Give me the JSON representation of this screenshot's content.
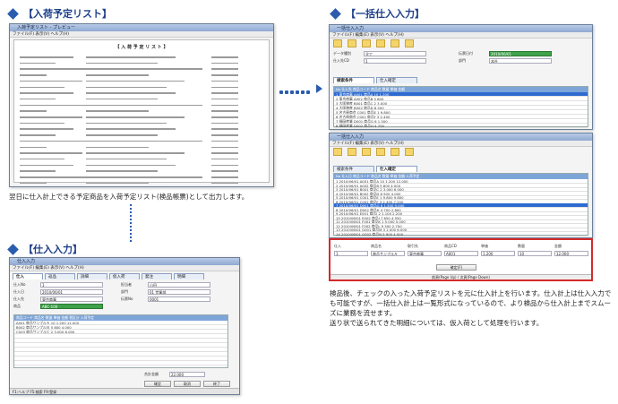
{
  "sections": {
    "schedule": {
      "heading": "【入荷予定リスト】",
      "desc": "翌日に仕入計上できる予定商品を入荷予定リスト(検品帳票)として出力します。"
    },
    "bulk": {
      "heading": "【一括仕入入力】",
      "desc": "検品後、チェックの入った入荷予定リストを元に仕入計上を行います。仕入計上は仕入入力でも可能ですが、一括仕入計上は一覧形式になっているので、より検品から仕入計上までスムーズに業務を流せます。\n送り状で送られてきた明細については、仮入荷として処理を行います。"
    },
    "entry": {
      "heading": "【仕入入力】"
    }
  },
  "report": {
    "title": "【 入 荷 予 定 リ ス ト 】"
  },
  "entry_win": {
    "title": "仕入入力",
    "menu": "ファイル(F)  編集(E)  表示(V)  ヘルプ(H)",
    "tabs": [
      "仕入",
      "返品",
      "詳細",
      "仮入荷",
      "発注",
      "明細"
    ],
    "labels": [
      "仕入No",
      "仕入日",
      "仕入先",
      "商品",
      "担当者",
      "部門",
      "伝票No"
    ],
    "values": [
      "1",
      "2010/06/01",
      "東京商事",
      "ABC-100",
      "山田",
      "01 営業部",
      "0001"
    ],
    "grid_header": "商品コード  商品名  数量  単価  金額  税区分  入荷予定",
    "rows": [
      "A001  商品サンプルＡ  10  1,200  12,000",
      "B002  商品サンプルＢ  5  800  4,000",
      "C003  商品サンプルＣ  2  3,000  6,000"
    ],
    "total_label": "合計金額",
    "total_value": "22,000",
    "buttons": [
      "確定",
      "取消",
      "終了"
    ],
    "status": "F1:ヘルプ  F5:検索  F9:登録"
  },
  "bulk_win_top": {
    "title": "一括仕入入力",
    "menu": "ファイル(F)  編集(E)  表示(V)  ヘルプ(H)",
    "labels": [
      "データ種別",
      "伝票日付",
      "仕入先CD",
      "部門"
    ],
    "values": [
      "全て",
      "2010/06/01",
      "1",
      "本社"
    ],
    "tabs": [
      "検索条件",
      "仕入確定"
    ],
    "grid_header": "No  仕入先  商品コード  商品名  数量  単価  金額",
    "rows": [
      "1  東京商事  A001  商品A  10  1,200",
      "2  東京商事  A002  商品B  5  800",
      "3  大阪物産  B001  商品C  2  3,000",
      "4  大阪物産  B002  商品D  8  500",
      "5  名古屋商会  C001  商品E  1  9,800",
      "6  名古屋商会  C002  商品F  3  2,400",
      "7  福岡産業  D001  商品G  6  1,500",
      "8  福岡産業  D002  商品H  4  700"
    ]
  },
  "bulk_win_bottom": {
    "title": "一括仕入入力",
    "menu": "ファイル(F)  編集(E)  表示(V)  ヘルプ(H)",
    "tabs": [
      "検索条件",
      "仕入確定"
    ],
    "grid_header": "No  仕入日  商品コード  商品名  数量  単価  金額  入荷予定",
    "rows": [
      "1 2010/06/01 A001 商品A 10 1,200 12,000",
      "2 2010/06/01 A002 商品B 5 800 4,000",
      "3 2010/06/01 B001 商品C 2 3,000 6,000",
      "4 2010/06/01 B002 商品D 8 500 4,000",
      "5 2010/06/01 C001 商品E 1 9,800 9,800",
      "6 2010/06/01 C002 商品F 3 2,400 7,200",
      "7 2010/06/01 D001 商品G 6 1,500 9,000",
      "8 2010/06/01 D002 商品H 4 700 2,800",
      "9 2010/06/01 E001 商品I 2 1,100 2,200",
      "10 2010/06/01 E002 商品J 7 650 4,550",
      "11 2010/06/01 F001 商品K 1 5,000 5,000",
      "12 2010/06/01 F002 商品L 9 300 2,700",
      "13 2010/06/01 G001 商品M 3 2,000 6,000",
      "14 2010/06/01 G002 商品N 5 900 4,500"
    ],
    "detail_labels": [
      "仕入",
      "商品名",
      "取引先",
      "商品CD",
      "単価",
      "数量",
      "金額"
    ],
    "detail_values": [
      "1",
      "商品サンプルＡ",
      "東京商事",
      "A001",
      "1,200",
      "10",
      "12,000"
    ],
    "confirm_button": "確定(F)",
    "status": "前頁(Page Up)  /  次頁(Page Down)"
  },
  "colors": {
    "accent": "#1d3f8a",
    "highlight": "#d52a2a",
    "selected_row": "#2e6bd1",
    "grid_header": "#7ea5d8"
  }
}
